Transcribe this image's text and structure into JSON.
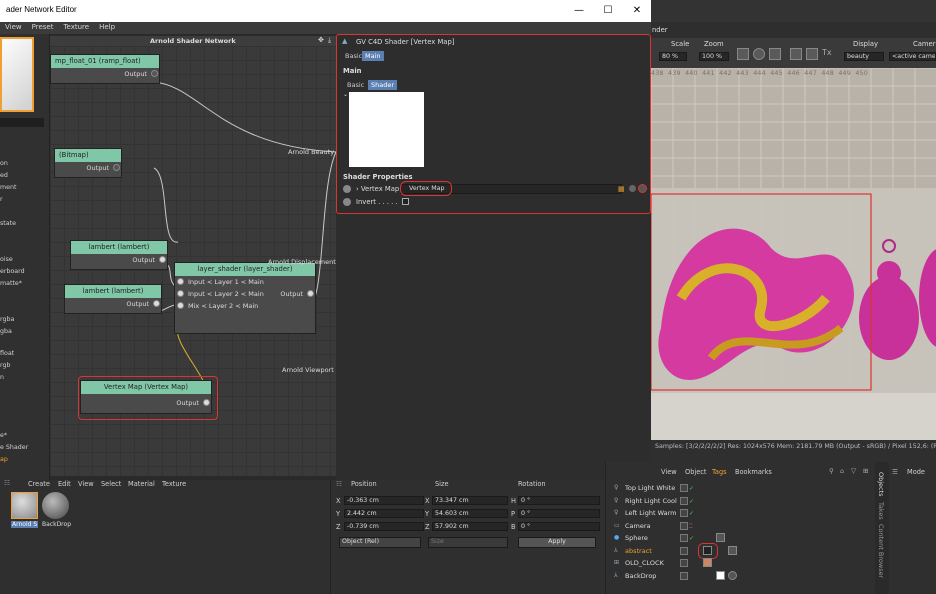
{
  "window": {
    "title": "ader Network Editor",
    "minimize": "—",
    "maximize": "☐",
    "close": "✕"
  },
  "menu": [
    "View",
    "Preset",
    "Texture",
    "Help"
  ],
  "left_panel": {
    "items": [
      "on",
      "ed",
      "ment",
      "r",
      "state",
      "oise",
      "erboard",
      "matte*",
      "rgba",
      "gba",
      "float",
      "rgb",
      "n",
      "e*",
      "e Shader",
      "ap"
    ]
  },
  "node_editor": {
    "title": "Arnold Shader Network",
    "nodes": {
      "ramp": {
        "title": "mp_float_01 (ramp_float)",
        "output": "Output"
      },
      "bitmap": {
        "title": "(Bitmap)",
        "output": "Output"
      },
      "lambert1": {
        "title": "lambert (lambert)",
        "output": "Output"
      },
      "lambert2": {
        "title": "lambert (lambert)",
        "output": "Output"
      },
      "layer": {
        "title": "layer_shader (layer_shader)",
        "input1": "Input < Layer 1 < Main",
        "input2": "Input < Layer 2 < Main",
        "mix": "Mix < Layer 2 < Main",
        "output": "Output"
      },
      "vertexmap": {
        "title": "Vertex Map (Vertex Map)",
        "output": "Output"
      }
    },
    "outputs": [
      "Arnold Beauty",
      "Arnold Displacement",
      "Arnold Viewport"
    ]
  },
  "attributes": {
    "header": "GV C4D Shader [Vertex Map]",
    "tabs": [
      "Basic",
      "Main"
    ],
    "section": "Main",
    "subtabs": [
      "Basic",
      "Shader"
    ],
    "shader_properties": "Shader Properties",
    "vertex_map_label": "Vertex Map",
    "vertex_map_value": "Vertex Map",
    "invert_label": "Invert . . . . ."
  },
  "render": {
    "topbar": "nder",
    "scale_label": "Scale",
    "zoom_label": "Zoom",
    "display_label": "Display",
    "camera_label": "Camera",
    "scale_value": "80 %",
    "zoom_value": "100 %",
    "display_value": "beauty",
    "camera_value": "<active camer",
    "status": "Samples: [3/2/2/2/2/2]  Res: 1024x576  Mem: 2181.79 MB  (Output - sRGB) / Pixel 152,6: (R: 0.",
    "grid_numbers": [
      "438",
      "439",
      "440",
      "441",
      "442",
      "443",
      "444",
      "445",
      "446",
      "447",
      "448",
      "449",
      "450"
    ]
  },
  "materials": {
    "menu": [
      "Create",
      "Edit",
      "View",
      "Select",
      "Material",
      "Texture"
    ],
    "items": [
      "Arnold S",
      "BackDrop"
    ]
  },
  "coordinates": {
    "headers": [
      "Position",
      "Size",
      "Rotation"
    ],
    "rows": [
      {
        "axis": "X",
        "pos": "-0.363 cm",
        "size_axis": "X",
        "size": "73.347 cm",
        "rot_axis": "H",
        "rot": "0 °"
      },
      {
        "axis": "Y",
        "pos": "2.442 cm",
        "size_axis": "Y",
        "size": "54.603 cm",
        "rot_axis": "P",
        "rot": "0 °"
      },
      {
        "axis": "Z",
        "pos": "-0.739 cm",
        "size_axis": "Z",
        "size": "57.902 cm",
        "rot_axis": "B",
        "rot": "0 °"
      }
    ],
    "mode": "Object (Rel)",
    "size_mode": "Size",
    "apply": "Apply"
  },
  "objects": {
    "menu": [
      "View",
      "Object",
      "Tags",
      "Bookmarks"
    ],
    "items": [
      "Top Light White",
      "Right Light Cool",
      "Left Light Warm",
      "Camera",
      "Sphere",
      "abstract",
      "OLD_CLOCK",
      "BackDrop"
    ]
  },
  "side_tabs": [
    "Objects",
    "Takes",
    "Content Browser"
  ],
  "mode_label": "Mode",
  "colors": {
    "accent_blue": "#5a7fb0",
    "highlight_red": "#dd3333",
    "node_green": "#7fc7a6",
    "node_blue": "#3a6fb8",
    "selected_orange": "#f0a030"
  }
}
